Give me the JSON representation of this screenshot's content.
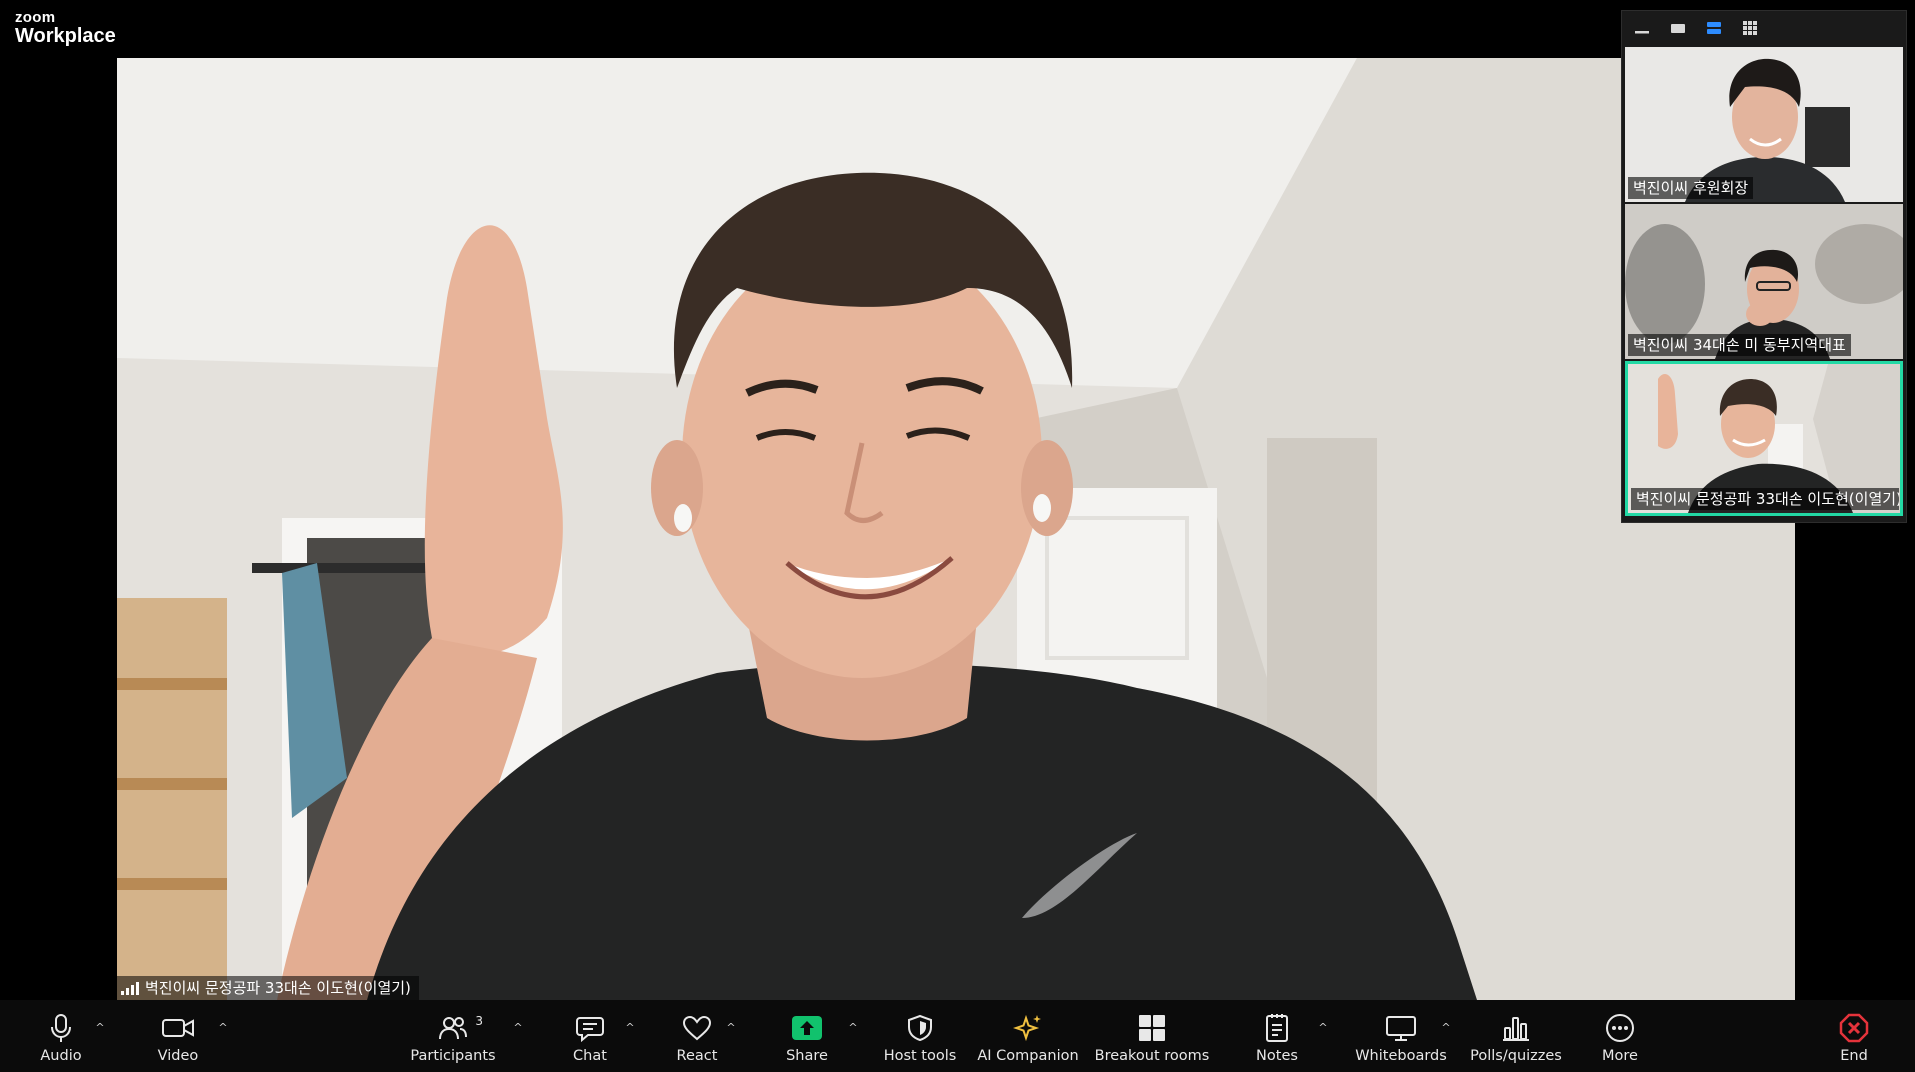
{
  "app": {
    "brand": "zoom",
    "product": "Workplace"
  },
  "main_video": {
    "participant_name": "벽진이씨 문정공파 33대손 이도현(이열기)"
  },
  "gallery": {
    "view_modes": [
      "minimize-icon",
      "speaker-view-icon",
      "side-by-side-icon",
      "gallery-grid-icon"
    ],
    "tiles": [
      {
        "name": "벽진이씨 후원회장",
        "active": false
      },
      {
        "name": "벽진이씨 34대손 미 동부지역대표",
        "active": false
      },
      {
        "name": "벽진이씨 문정공파 33대손 이도현(이열기)",
        "active": true
      }
    ]
  },
  "toolbar": {
    "participants_count": "3",
    "items": [
      {
        "label": "Audio",
        "icon": "microphone-icon"
      },
      {
        "label": "Video",
        "icon": "video-camera-icon"
      },
      {
        "label": "Participants",
        "icon": "participants-icon"
      },
      {
        "label": "Chat",
        "icon": "chat-icon"
      },
      {
        "label": "React",
        "icon": "heart-icon"
      },
      {
        "label": "Share",
        "icon": "share-icon"
      },
      {
        "label": "Host tools",
        "icon": "shield-icon"
      },
      {
        "label": "AI Companion",
        "icon": "sparkle-icon"
      },
      {
        "label": "Breakout rooms",
        "icon": "breakout-rooms-icon"
      },
      {
        "label": "Notes",
        "icon": "notes-icon"
      },
      {
        "label": "Whiteboards",
        "icon": "whiteboard-icon"
      },
      {
        "label": "Polls/quizzes",
        "icon": "polls-icon"
      },
      {
        "label": "More",
        "icon": "more-icon"
      },
      {
        "label": "End",
        "icon": "end-call-icon"
      }
    ]
  },
  "colors": {
    "active_speaker": "#23d9a5",
    "share_green": "#11c26d",
    "end_red": "#e5333b",
    "toolbar_bg": "#0b0b0b"
  }
}
